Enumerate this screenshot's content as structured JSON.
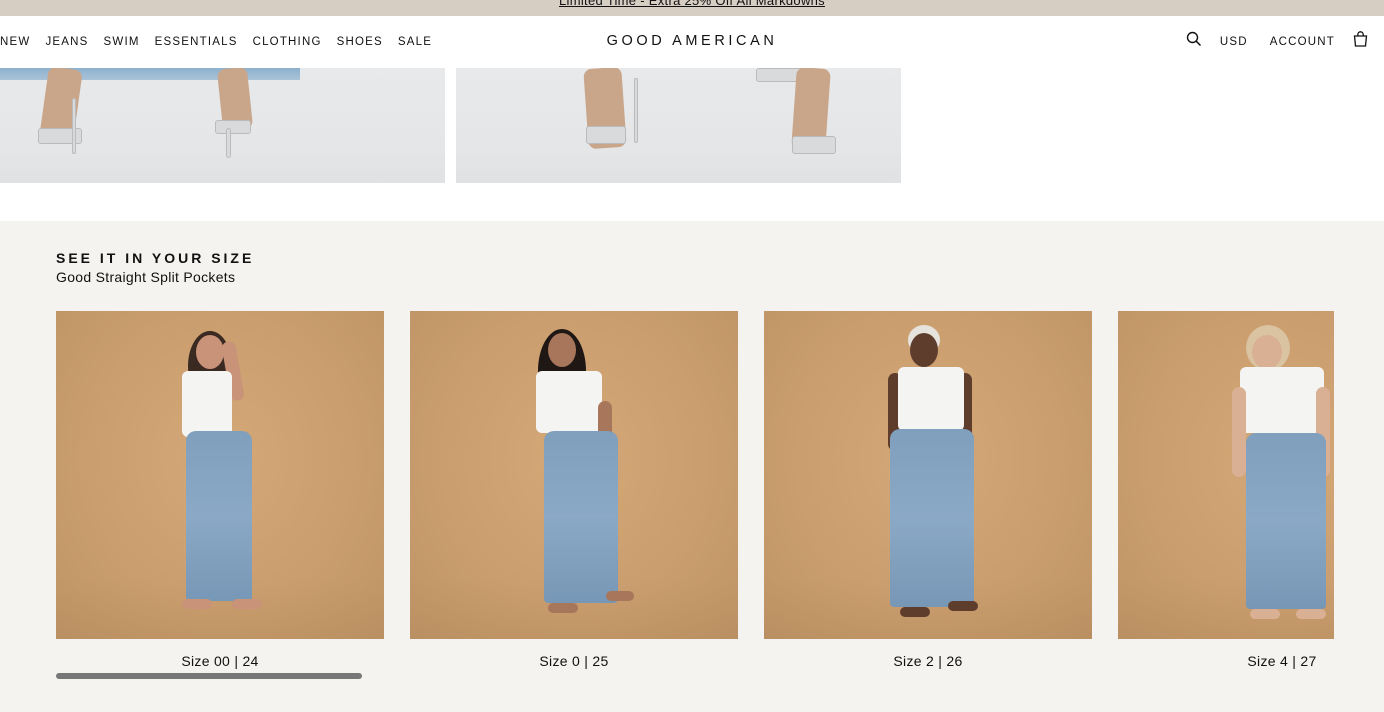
{
  "announcement": {
    "text": "Limited Time - Extra 25% Off All Markdowns"
  },
  "header": {
    "nav": [
      "NEW",
      "JEANS",
      "SWIM",
      "ESSENTIALS",
      "CLOTHING",
      "SHOES",
      "SALE"
    ],
    "logo": "GOOD AMERICAN",
    "currency": "USD",
    "account": "ACCOUNT",
    "icons": [
      "search-icon",
      "shopping-bag-icon"
    ]
  },
  "section": {
    "title": "SEE IT IN YOUR SIZE",
    "subtitle": "Good Straight Split Pockets",
    "slides": [
      {
        "caption": "Size 00 | 24"
      },
      {
        "caption": "Size 0 | 25"
      },
      {
        "caption": "Size 2 | 26"
      },
      {
        "caption": "Size 4 | 27"
      }
    ]
  },
  "colors": {
    "announcement_bg": "#d6cdc3",
    "section_bg": "#f5f3ef",
    "photo_bg": "#c99d6d",
    "scrollbar": "#777777"
  }
}
